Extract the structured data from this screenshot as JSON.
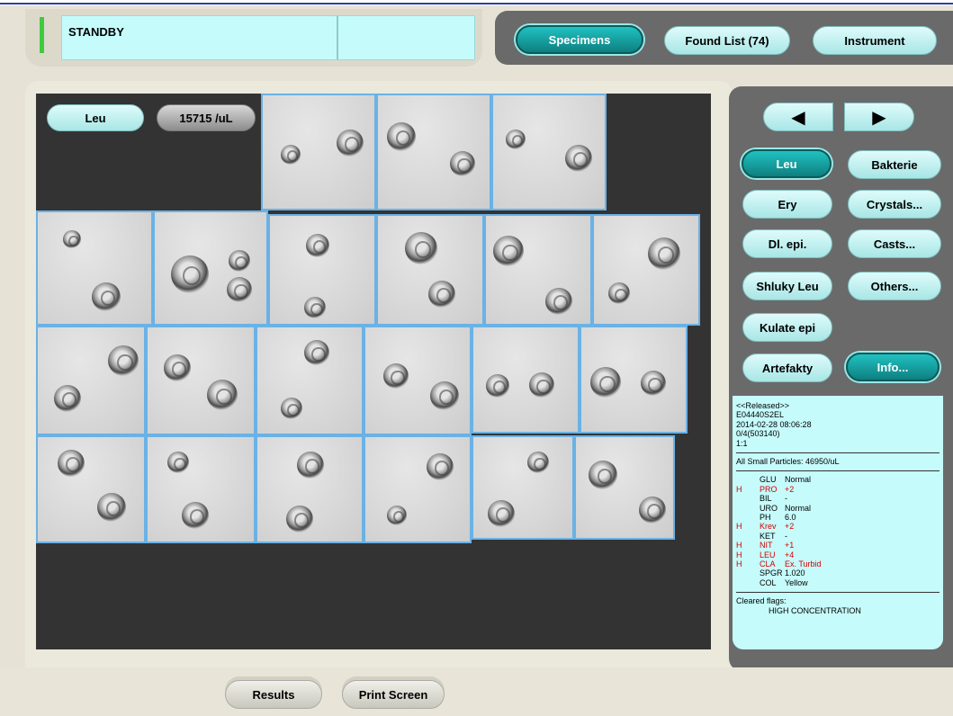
{
  "status": {
    "text": "STANDBY"
  },
  "top_tabs": [
    {
      "label": "Specimens",
      "active": true
    },
    {
      "label": "Found List (74)",
      "active": false
    },
    {
      "label": "Instrument",
      "active": false
    }
  ],
  "category": {
    "name": "Leu",
    "concentration": "15715 /uL"
  },
  "nav": {
    "prev_icon": "left-arrow-icon",
    "next_icon": "right-arrow-icon",
    "prev": "◀",
    "next": "▶"
  },
  "categories": [
    {
      "label": "Leu",
      "active": true
    },
    {
      "label": "Bakterie",
      "active": false
    },
    {
      "label": "Ery",
      "active": false
    },
    {
      "label": "Crystals...",
      "active": false
    },
    {
      "label": "Dl. epi.",
      "active": false
    },
    {
      "label": "Casts...",
      "active": false
    },
    {
      "label": "Shluky Leu",
      "active": false
    },
    {
      "label": "Others...",
      "active": false
    },
    {
      "label": "Kulate epi",
      "active": false
    },
    {
      "label": "Artefakty",
      "active": false
    },
    {
      "label": "Info...",
      "active": true
    }
  ],
  "info": {
    "header_lines": [
      "<<Released>>",
      "E04440S2EL",
      "2014-02-28 08:06:28",
      "0/4(503140)",
      "1:1"
    ],
    "small_particles": "All Small Particles: 46950/uL",
    "lab": [
      {
        "flag": "",
        "code": "GLU",
        "value": "Normal"
      },
      {
        "flag": "H",
        "code": "PRO",
        "value": "+2"
      },
      {
        "flag": "",
        "code": "BIL",
        "value": "-"
      },
      {
        "flag": "",
        "code": "URO",
        "value": "Normal"
      },
      {
        "flag": "",
        "code": "PH",
        "value": "6.0"
      },
      {
        "flag": "H",
        "code": "Krev",
        "value": "+2"
      },
      {
        "flag": "",
        "code": "KET",
        "value": "-"
      },
      {
        "flag": "H",
        "code": "NIT",
        "value": "+1"
      },
      {
        "flag": "H",
        "code": "LEU",
        "value": "+4"
      },
      {
        "flag": "H",
        "code": "CLA",
        "value": "Ex. Turbid"
      },
      {
        "flag": "",
        "code": "SPGR",
        "value": "1.020"
      },
      {
        "flag": "",
        "code": "COL",
        "value": "Yellow"
      }
    ],
    "cleared_label": "Cleared flags:",
    "cleared_value": "HIGH CONCENTRATION"
  },
  "bottom_buttons": {
    "results": "Results",
    "print": "Print Screen"
  },
  "colors": {
    "accent": "#0e7f80",
    "panel": "#c6fbfb",
    "flag_high": "#d40000",
    "thumb_border": "#6ab2e6"
  }
}
